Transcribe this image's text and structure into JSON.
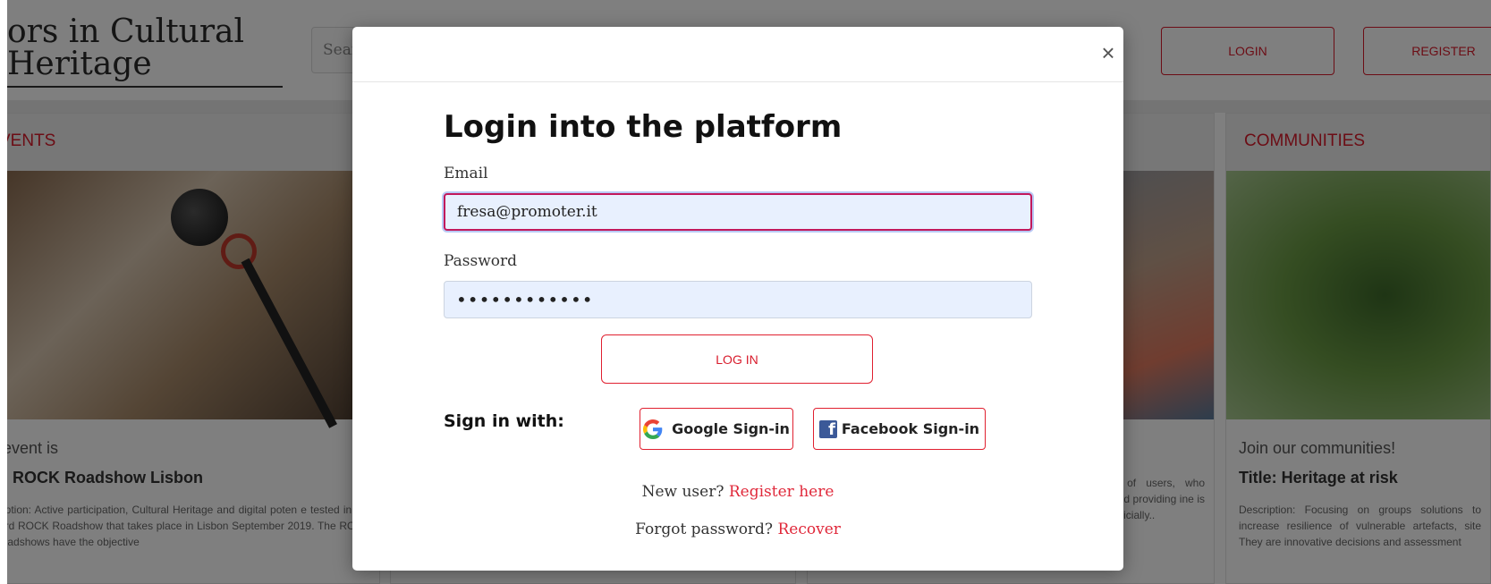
{
  "header": {
    "site_title": "ors in Cultural\nHeritage",
    "search_placeholder": "Sear",
    "login_label": "LOGIN",
    "register_label": "REGISTER"
  },
  "cards": {
    "events": {
      "heading": "VENTS",
      "subtitle": "t event is",
      "title": "e: ROCK Roadshow Lisbon",
      "description": "cription: Active participation, Cultural Heritage and digital poten e tested in the third ROCK Roadshow that takes place in Lisbon September 2019. The ROCK Roadshows have the objective"
    },
    "middle": {
      "description": "y of users, who and providing ine is officially.."
    },
    "communities": {
      "heading": "COMMUNITIES",
      "subtitle": "Join our communities!",
      "title": "Title: Heritage at risk",
      "description": "Description: Focusing on groups solutions to increase resilience of vulnerable artefacts, site They are innovative decisions and assessment"
    }
  },
  "modal": {
    "close_symbol": "×",
    "title": "Login into the platform",
    "email_label": "Email",
    "email_value": "fresa@promoter.it",
    "password_label": "Password",
    "password_value": "••••••••••••",
    "login_button": "LOG IN",
    "signin_with_label": "Sign in with:",
    "google_label": "Google Sign-in",
    "facebook_label": "Facebook Sign-in",
    "new_user_text": "New user?",
    "register_link": "Register here",
    "forgot_text": "Forgot password?",
    "recover_link": "Recover"
  },
  "colors": {
    "accent_red": "#d81b2b",
    "input_fill": "#e8f0fe",
    "facebook_blue": "#3b5998"
  },
  "icons": [
    "google-icon",
    "facebook-icon",
    "close-icon"
  ]
}
